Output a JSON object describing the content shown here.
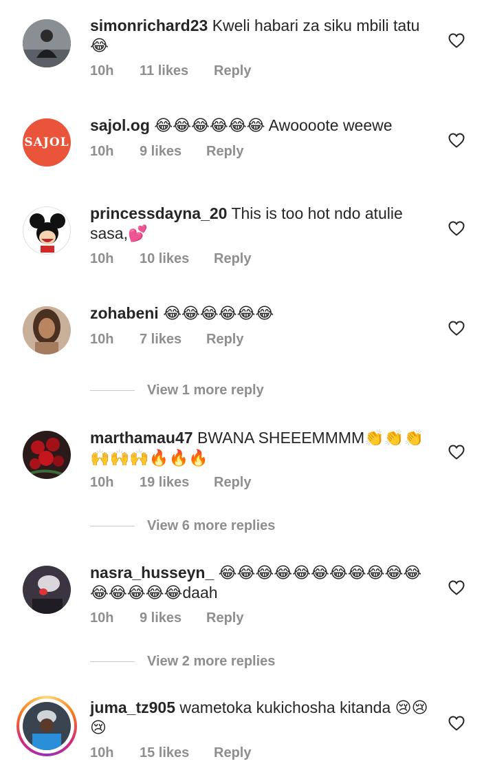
{
  "comments": [
    {
      "username": "simonrichard23",
      "text": "Kweli habari za siku mbili tatu 😂",
      "time": "10h",
      "likes": "11 likes",
      "reply": "Reply"
    },
    {
      "username": "sajol.og",
      "text": "😂😂😂😂😂😂 Awoooote weewe",
      "time": "10h",
      "likes": "9 likes",
      "reply": "Reply",
      "avatar_text": "SAJOL"
    },
    {
      "username": "princessdayna_20",
      "text": "This is too hot ndo atulie sasa,💕",
      "time": "10h",
      "likes": "10 likes",
      "reply": "Reply"
    },
    {
      "username": "zohabeni",
      "text": "😂😂😂😂😂😂",
      "time": "10h",
      "likes": "7 likes",
      "reply": "Reply",
      "view_more": "View 1 more reply"
    },
    {
      "username": "marthamau47",
      "text": "BWANA SHEEEMMMM👏👏👏🙌🙌🙌🔥🔥🔥",
      "time": "10h",
      "likes": "19 likes",
      "reply": "Reply",
      "view_more": "View 6 more replies"
    },
    {
      "username": "nasra_husseyn_",
      "text": "😂😂😂😂😂😂😂😂😂😂😂😂😂😂😂😂daah",
      "time": "10h",
      "likes": "9 likes",
      "reply": "Reply",
      "view_more": "View 2 more replies"
    },
    {
      "username": "juma_tz905",
      "text": "wametoka kukichosha kitanda 😢😢😢",
      "time": "10h",
      "likes": "15 likes",
      "reply": "Reply"
    }
  ],
  "icons": {
    "like": "heart-outline-icon"
  },
  "colors": {
    "text": "#262626",
    "meta": "#8e8e8e",
    "sajol_avatar": "#e9543a",
    "story_ring": "#d6249f"
  }
}
